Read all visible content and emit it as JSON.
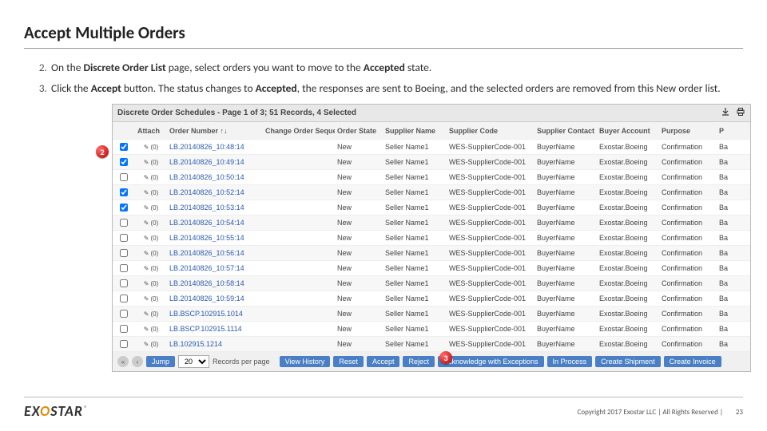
{
  "title": "Accept Multiple Orders",
  "instructions_start": 2,
  "instructions": [
    {
      "pre": "On the ",
      "b1": "Discrete Order List",
      "mid": " page, select orders you want to move to the ",
      "b2": "Accepted",
      "post": " state."
    },
    {
      "pre": "Click the ",
      "b1": "Accept",
      "mid": " button. The status changes to ",
      "b2": "Accepted",
      "post": ", the responses are sent to Boeing, and the selected orders are removed from this New order list."
    }
  ],
  "screenshot": {
    "bar_title": "Discrete Order Schedules - Page 1 of 3; 51 Records, 4 Selected",
    "columns": [
      "",
      "Attach",
      "Order Number ↑↓",
      "Change Order Sequence",
      "Order State",
      "Supplier Name",
      "Supplier Code",
      "Supplier Contact",
      "Buyer Account",
      "Purpose",
      "P",
      ""
    ],
    "att_label": "(0)",
    "rows": [
      {
        "checked": true,
        "order": "LB.20140826_10:48:14",
        "state": "New",
        "sname": "Seller Name1",
        "scode": "WES-SupplierCode-001",
        "contact": "BuyerName",
        "buyer": "Exostar.Boeing",
        "purpose": "Confirmation",
        "p": "Ba"
      },
      {
        "checked": true,
        "order": "LB.20140826_10:49:14",
        "state": "New",
        "sname": "Seller Name1",
        "scode": "WES-SupplierCode-001",
        "contact": "BuyerName",
        "buyer": "Exostar.Boeing",
        "purpose": "Confirmation",
        "p": "Ba"
      },
      {
        "checked": false,
        "order": "LB.20140826_10:50:14",
        "state": "New",
        "sname": "Seller Name1",
        "scode": "WES-SupplierCode-001",
        "contact": "BuyerName",
        "buyer": "Exostar.Boeing",
        "purpose": "Confirmation",
        "p": "Ba"
      },
      {
        "checked": true,
        "order": "LB.20140826_10:52:14",
        "state": "New",
        "sname": "Seller Name1",
        "scode": "WES-SupplierCode-001",
        "contact": "BuyerName",
        "buyer": "Exostar.Boeing",
        "purpose": "Confirmation",
        "p": "Ba"
      },
      {
        "checked": true,
        "order": "LB.20140826_10:53:14",
        "state": "New",
        "sname": "Seller Name1",
        "scode": "WES-SupplierCode-001",
        "contact": "BuyerName",
        "buyer": "Exostar.Boeing",
        "purpose": "Confirmation",
        "p": "Ba"
      },
      {
        "checked": false,
        "order": "LB.20140826_10:54:14",
        "state": "New",
        "sname": "Seller Name1",
        "scode": "WES-SupplierCode-001",
        "contact": "BuyerName",
        "buyer": "Exostar.Boeing",
        "purpose": "Confirmation",
        "p": "Ba"
      },
      {
        "checked": false,
        "order": "LB.20140826_10:55:14",
        "state": "New",
        "sname": "Seller Name1",
        "scode": "WES-SupplierCode-001",
        "contact": "BuyerName",
        "buyer": "Exostar.Boeing",
        "purpose": "Confirmation",
        "p": "Ba"
      },
      {
        "checked": false,
        "order": "LB.20140826_10:56:14",
        "state": "New",
        "sname": "Seller Name1",
        "scode": "WES-SupplierCode-001",
        "contact": "BuyerName",
        "buyer": "Exostar.Boeing",
        "purpose": "Confirmation",
        "p": "Ba"
      },
      {
        "checked": false,
        "order": "LB.20140826_10:57:14",
        "state": "New",
        "sname": "Seller Name1",
        "scode": "WES-SupplierCode-001",
        "contact": "BuyerName",
        "buyer": "Exostar.Boeing",
        "purpose": "Confirmation",
        "p": "Ba"
      },
      {
        "checked": false,
        "order": "LB.20140826_10:58:14",
        "state": "New",
        "sname": "Seller Name1",
        "scode": "WES-SupplierCode-001",
        "contact": "BuyerName",
        "buyer": "Exostar.Boeing",
        "purpose": "Confirmation",
        "p": "Ba"
      },
      {
        "checked": false,
        "order": "LB.20140826_10:59:14",
        "state": "New",
        "sname": "Seller Name1",
        "scode": "WES-SupplierCode-001",
        "contact": "BuyerName",
        "buyer": "Exostar.Boeing",
        "purpose": "Confirmation",
        "p": "Ba"
      },
      {
        "checked": false,
        "order": "LB.BSCP.102915.1014",
        "state": "New",
        "sname": "Seller Name1",
        "scode": "WES-SupplierCode-001",
        "contact": "BuyerName",
        "buyer": "Exostar.Boeing",
        "purpose": "Confirmation",
        "p": "Ba"
      },
      {
        "checked": false,
        "order": "LB.BSCP.102915.1114",
        "state": "New",
        "sname": "Seller Name1",
        "scode": "WES-SupplierCode-001",
        "contact": "BuyerName",
        "buyer": "Exostar.Boeing",
        "purpose": "Confirmation",
        "p": "Ba"
      },
      {
        "checked": false,
        "order": "LB.102915.1214",
        "state": "New",
        "sname": "Seller Name1",
        "scode": "WES-SupplierCode-001",
        "contact": "BuyerName",
        "buyer": "Exostar.Boeing",
        "purpose": "Confirmation",
        "p": "Ba"
      }
    ],
    "footer": {
      "jump": "Jump",
      "per_page": "20",
      "rpp_label": "Records per page",
      "buttons": [
        {
          "label": "View History",
          "color": "#4a7fc5"
        },
        {
          "label": "Reset",
          "color": "#4a7fc5"
        },
        {
          "label": "Accept",
          "color": "#4a7fc5"
        },
        {
          "label": "Reject",
          "color": "#4a7fc5"
        },
        {
          "label": "Acknowledge with Exceptions",
          "color": "#4a7fc5"
        },
        {
          "label": "In Process",
          "color": "#4a7fc5"
        },
        {
          "label": "Create Shipment",
          "color": "#4a7fc5"
        },
        {
          "label": "Create Invoice",
          "color": "#4a7fc5"
        }
      ]
    }
  },
  "callouts": {
    "c2": "2",
    "c3": "3"
  },
  "footer": {
    "logo_ex": "EX",
    "logo_o": "O",
    "logo_star": "STAR",
    "reg": "®",
    "copyright": "Copyright 2017 Exostar LLC | All Rights Reserved |",
    "page": "23"
  }
}
